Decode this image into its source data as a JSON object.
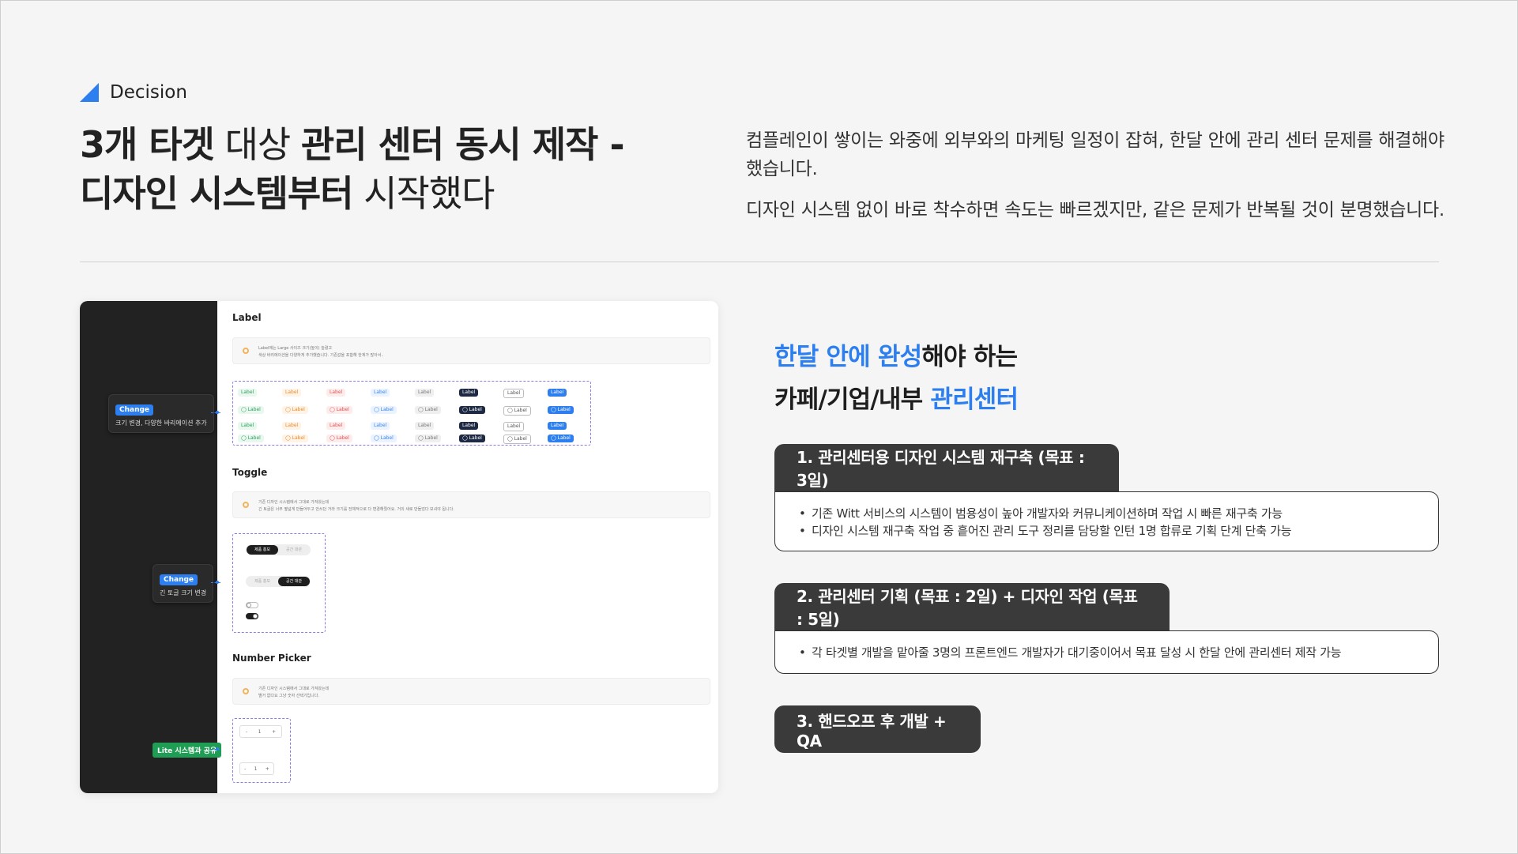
{
  "section": {
    "label": "Decision"
  },
  "title": {
    "line1_bold_a": "3개 타겟",
    "line1_light": " 대상 ",
    "line1_bold_b": "관리 센터 동시 제작 -",
    "line2_bold": "디자인 시스템부터",
    "line2_light": " 시작했다"
  },
  "description": {
    "p1": "컴플레인이 쌓이는 와중에 외부와의 마케팅 일정이 잡혀, 한달 안에 관리 센터 문제를 해결해야 했습니다.",
    "p2": "디자인 시스템 없이 바로 착수하면 속도는 빠르겠지만, 같은 문제가 반복될 것이 분명했습니다."
  },
  "mock": {
    "notes": [
      {
        "chip": "Change",
        "text": "크기 변경, 다양한 바리에이션 추가"
      },
      {
        "chip": "Change",
        "text": "긴 토글 크기 변경"
      },
      {
        "chip": "Lite 시스템과 공유",
        "text": ""
      }
    ],
    "sections": {
      "label_title": "Label",
      "label_desc_1": "Label에는 Large 사이즈 크기(높이) 늘렸고",
      "label_desc_2": "색상 바리에이션을 다양하게 추가했습니다. 기존값을 포함해 한계가 많아서..",
      "toggle_title": "Toggle",
      "toggle_desc_1": "기존 디자인 시스템에서 그대로 가져왔는데",
      "toggle_desc_2": "긴 토글은 너무 옆넓게 만들어두고 안쓰던 거라 크기를 전체적으로 다 변경해줬어요. 거의 새로 만들었다 보셔야 됩니다.",
      "number_title": "Number Picker",
      "number_desc_1": "기존 디자인 시스템에서 그대로 가져왔는데",
      "number_desc_2": "별거 없다요 그냥 숫자 선택기입니다."
    },
    "label_text": "Label",
    "toggle_on": "제품 홍보",
    "toggle_off": "공간 대관",
    "stepper": {
      "minus": "-",
      "value": "1",
      "plus": "+"
    }
  },
  "headline": {
    "l1_blue": "한달 안에 완성",
    "l1_rest": "해야 하는",
    "l2_black": "카페/기업/내부 ",
    "l2_blue": "관리센터"
  },
  "steps": [
    {
      "title": "1. 관리센터용 디자인 시스템 재구축 (목표 : 3일)",
      "bullets": [
        "기존 Witt 서비스의 시스템이 범용성이 높아 개발자와 커뮤니케이션하며 작업 시 빠른 재구축 가능",
        "디자인 시스템 재구축 작업 중 흩어진 관리 도구 정리를 담당할 인턴 1명 합류로 기획 단계 단축 가능"
      ]
    },
    {
      "title": "2. 관리센터 기획 (목표 : 2일) + 디자인 작업 (목표 : 5일)",
      "bullets": [
        "각 타겟별 개발을 맡아줄 3명의 프론트엔드 개발자가 대기중이어서 목표 달성 시 한달 안에 관리센터 제작 가능"
      ]
    },
    {
      "title": "3. 핸드오프 후 개발 + QA",
      "bullets": []
    }
  ],
  "colors": {
    "accent": "#2d7ff0",
    "dark": "#3a3a3a",
    "sidebar": "#222222",
    "green": "#1f9d55"
  }
}
